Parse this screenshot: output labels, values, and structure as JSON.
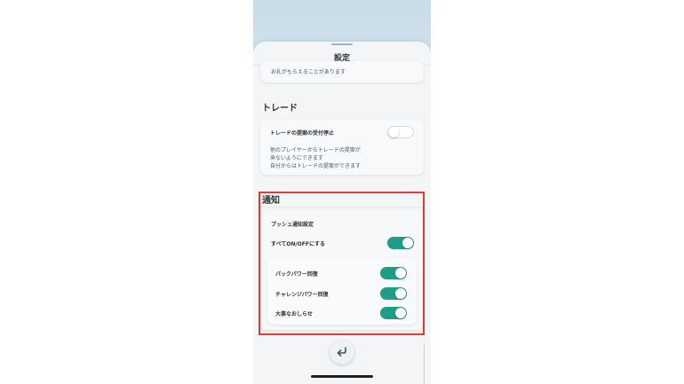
{
  "panel": {
    "title": "設定"
  },
  "top_card": {
    "text": "お礼がもらえることがあります"
  },
  "trade": {
    "heading": "トレード",
    "label": "トレードの提案の受付停止",
    "desc_line1": "他のプレイヤーからトレードの提案が",
    "desc_line2": "来ないようにできます",
    "desc_line3": "自分からはトレードの提案ができます",
    "toggle_state": "off"
  },
  "notifications": {
    "heading": "通知",
    "push_heading": "プッシュ通知設定",
    "all_label": "すべてON/OFFにする",
    "all_state": "on",
    "items": [
      {
        "label": "パックパワー回復",
        "state": "on"
      },
      {
        "label": "チャレンジパワー回復",
        "state": "on"
      },
      {
        "label": "大事なおしらせ",
        "state": "on"
      }
    ]
  },
  "colors": {
    "toggle_on": "#1f9e87",
    "highlight": "#e53935"
  },
  "icons": {
    "back": "return-arrow-icon"
  }
}
